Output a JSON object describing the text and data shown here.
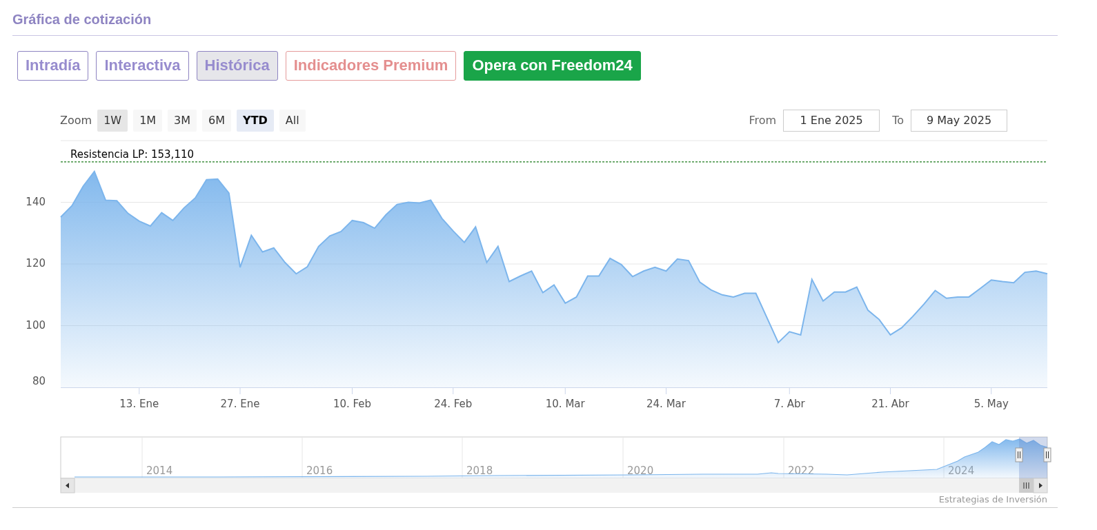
{
  "section_title": "Gráfica de cotización",
  "tabs": [
    {
      "label": "Intradía",
      "kind": "tab",
      "selected": false
    },
    {
      "label": "Interactiva",
      "kind": "tab",
      "selected": false
    },
    {
      "label": "Histórica",
      "kind": "tab",
      "selected": true
    },
    {
      "label": "Indicadores Premium",
      "kind": "premium",
      "selected": false
    },
    {
      "label": "Opera con Freedom24",
      "kind": "cta",
      "selected": false
    }
  ],
  "range_selector": {
    "label": "Zoom",
    "buttons": [
      {
        "label": "1W",
        "selected": false,
        "hovered": true
      },
      {
        "label": "1M",
        "selected": false,
        "hovered": false
      },
      {
        "label": "3M",
        "selected": false,
        "hovered": false
      },
      {
        "label": "6M",
        "selected": false,
        "hovered": false
      },
      {
        "label": "YTD",
        "selected": true,
        "hovered": false
      },
      {
        "label": "All",
        "selected": false,
        "hovered": false
      }
    ]
  },
  "date_range": {
    "from_label": "From",
    "from": "1 Ene 2025",
    "to_label": "To",
    "to": "9 May 2025"
  },
  "chart": {
    "chart_data": {
      "type": "area",
      "categories": [
        null,
        null,
        null,
        null,
        null,
        null,
        null,
        "13. Ene",
        null,
        null,
        null,
        null,
        null,
        null,
        null,
        null,
        "27. Ene",
        null,
        null,
        null,
        null,
        null,
        null,
        null,
        null,
        null,
        "10. Feb",
        null,
        null,
        null,
        null,
        null,
        null,
        null,
        null,
        "24. Feb",
        null,
        null,
        null,
        null,
        null,
        null,
        null,
        null,
        null,
        "10. Mar",
        null,
        null,
        null,
        null,
        null,
        null,
        null,
        null,
        "24. Mar",
        null,
        null,
        null,
        null,
        null,
        null,
        null,
        null,
        null,
        null,
        "7. Abr",
        null,
        null,
        null,
        null,
        null,
        null,
        null,
        null,
        "21. Abr",
        null,
        null,
        null,
        null,
        null,
        null,
        null,
        null,
        "5. May",
        null,
        null,
        null,
        null,
        null
      ],
      "series": [
        {
          "color": "#7cb5ec",
          "values": [
            135.2,
            138.9,
            145.2,
            150.0,
            140.7,
            140.5,
            136.4,
            133.9,
            132.3,
            136.6,
            134.1,
            138.2,
            141.4,
            147.3,
            147.5,
            143.0,
            118.9,
            129.3,
            123.9,
            125.2,
            120.5,
            116.8,
            119.1,
            125.7,
            129.1,
            130.5,
            134.1,
            133.4,
            131.6,
            135.9,
            139.3,
            140.0,
            139.8,
            140.7,
            134.8,
            130.7,
            127.0,
            132.0,
            120.5,
            125.7,
            114.3,
            116.1,
            117.7,
            110.7,
            113.2,
            107.3,
            109.3,
            116.1,
            116.1,
            121.8,
            119.8,
            115.9,
            117.7,
            118.9,
            117.7,
            121.6,
            121.1,
            114.1,
            111.6,
            110.0,
            109.3,
            110.5,
            110.5,
            102.5,
            94.5,
            98.0,
            97.0,
            115.0,
            108.0,
            110.9,
            110.9,
            112.5,
            105.0,
            102.0,
            97.0,
            99.3,
            103.0,
            107.0,
            111.4,
            108.9,
            109.3,
            109.3,
            112.0,
            114.8,
            114.3,
            113.9,
            117.3,
            117.7,
            116.8
          ]
        }
      ],
      "ylim": [
        80,
        160
      ],
      "grid": true,
      "yticks": [
        80,
        100,
        120,
        140
      ],
      "ref_lines": [
        {
          "axis": "y",
          "value": 153.11,
          "label": "Resistencia LP: 153,110"
        }
      ]
    }
  },
  "navigator": {
    "year_labels": [
      "2014",
      "2016",
      "2018",
      "2020",
      "2022",
      "2024"
    ]
  },
  "credits": "Estrategias de Inversión"
}
